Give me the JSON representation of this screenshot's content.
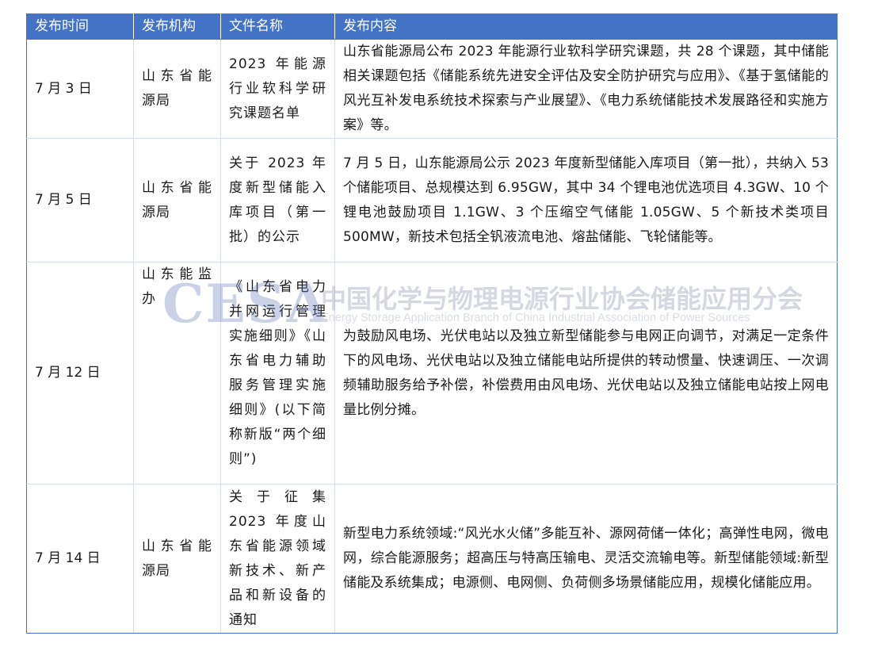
{
  "table": {
    "headers": [
      "发布时间",
      "发布机构",
      "文件名称",
      "发布内容"
    ],
    "rows": [
      {
        "date": "7 月 3 日",
        "org": "山东省能源局",
        "file": "2023 年能源行业软科学研究课题名单",
        "content": "山东省能源局公布 2023 年能源行业软科学研究课题，共 28 个课题，其中储能相关课题包括《储能系统先进安全评估及安全防护研究与应用》、《基于氢储能的风光互补发电系统技术探索与产业展望》、《电力系统储能技术发展路径和实施方案》等。"
      },
      {
        "date": "7 月 5 日",
        "org": "山东省能源局",
        "file": "关于 2023 年度新型储能入库项目（第一批）的公示",
        "content": "7 月 5 日，山东能源局公示 2023 年度新型储能入库项目（第一批），共纳入 53 个储能项目、总规模达到 6.95GW，其中 34 个锂电池优选项目 4.3GW、10 个锂电池鼓励项目 1.1GW、3 个压缩空气储能 1.05GW、5 个新技术类项目 500MW，新技术包括全钒液流电池、熔盐储能、飞轮储能等。"
      },
      {
        "date": "7 月 12 日",
        "org": "山东能监办",
        "file": "《山东省电力并网运行管理实施细则》《山东省电力辅助服务管理实施细则》(以下简称新版“两个细则”)",
        "content": "为鼓励风电场、光伏电站以及独立新型储能参与电网正向调节，对满足一定条件下的风电场、光伏电站以及独立储能电站所提供的转动惯量、快速调压、一次调频辅助服务给予补偿，补偿费用由风电场、光伏电站以及独立储能电站按上网电量比例分摊。"
      },
      {
        "date": "7 月 14 日",
        "org": "山东省能源局",
        "file": "关于征集 2023 年度山东省能源领域新技术、新产品和新设备的通知",
        "content": "新型电力系统领域:“风光水火储”多能互补、源网荷储一体化；高弹性电网，微电网，综合能源服务；超高压与特高压输电、灵活交流输电等。新型储能领域:新型储能及系统集成；电源侧、电网侧、负荷侧多场景储能应用，规模化储能应用。"
      }
    ]
  },
  "watermark": {
    "logo": "CESA",
    "cn": "中国化学与物理电源行业协会储能应用分会",
    "en": "Energy Storage Application Branch of China Industrial Association of Power Sources"
  },
  "colors": {
    "header_bg": "#4472c4",
    "header_text": "#ffffff"
  }
}
